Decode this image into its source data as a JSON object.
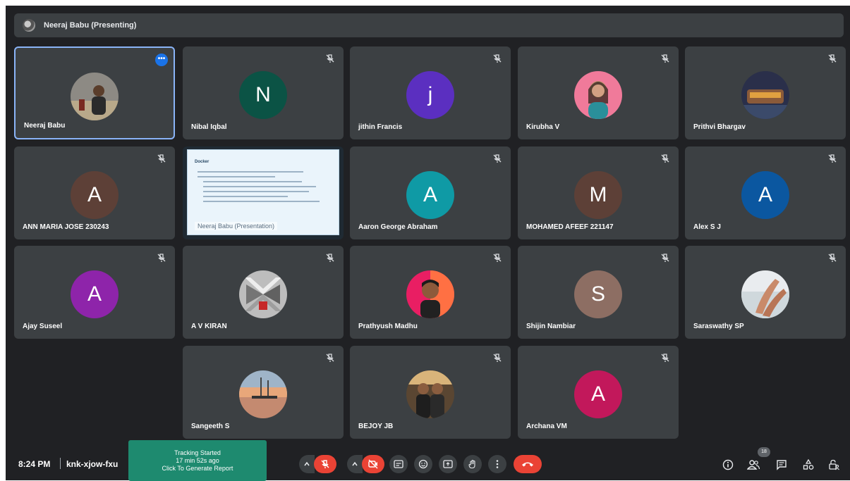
{
  "presenter_bar": {
    "label": "Neeraj Babu (Presenting)"
  },
  "tiles": [
    {
      "name": "Neeraj Babu"
    },
    {
      "name": "Nibal Iqbal",
      "initial": "N",
      "color": "#0b5345"
    },
    {
      "name": "jithin Francis",
      "initial": "j",
      "color": "#5b2fc0"
    },
    {
      "name": "Kirubha V"
    },
    {
      "name": "Prithvi Bhargav"
    },
    {
      "name": "ANN MARIA JOSE 230243",
      "initial": "A",
      "color": "#5d4037"
    },
    {
      "name": "Neeraj Babu (Presentation)"
    },
    {
      "name": "Aaron George Abraham",
      "initial": "A",
      "color": "#0f9aa5"
    },
    {
      "name": "MOHAMED AFEEF 221147",
      "initial": "M",
      "color": "#5d4037"
    },
    {
      "name": "Alex S J",
      "initial": "A",
      "color": "#0b57a0"
    },
    {
      "name": "Ajay Suseel",
      "initial": "A",
      "color": "#8e24aa"
    },
    {
      "name": "A V KIRAN"
    },
    {
      "name": "Prathyush Madhu"
    },
    {
      "name": "Shijin Nambiar",
      "initial": "S",
      "color": "#8d6e63"
    },
    {
      "name": "Saraswathy SP"
    },
    {
      "name": "Sangeeth S"
    },
    {
      "name": "BEJOY JB"
    },
    {
      "name": "Archana VM",
      "initial": "A",
      "color": "#c2185b"
    }
  ],
  "slide": {
    "title": "Docker"
  },
  "bottom": {
    "time": "8:24 PM",
    "meeting_code": "knk-xjow-fxu",
    "tracking": {
      "line1": "Tracking Started",
      "line2": "17 min 52s ago",
      "line3": "Click To Generate Report"
    },
    "participant_count": "18"
  },
  "colors": {
    "stage": "#202124",
    "tile": "#3c4043",
    "accent": "#1a73e8",
    "end_call": "#ea4335"
  }
}
